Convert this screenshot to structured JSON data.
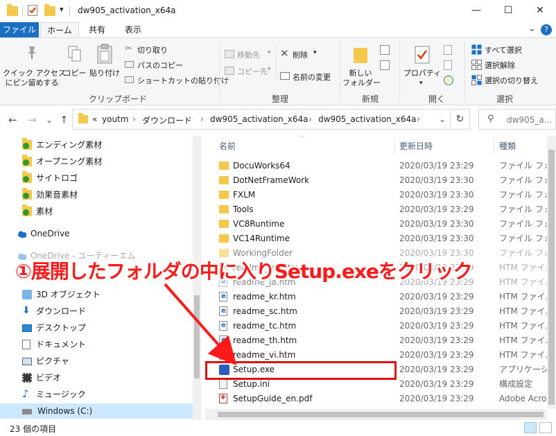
{
  "titlebar": {
    "title": "dw905_activation_x64a",
    "minimize": "—",
    "maximize": "☐",
    "close": "✕",
    "qat_dropdown": "▾"
  },
  "ribbon_tabs": {
    "file": "ファイル",
    "home": "ホーム",
    "share": "共有",
    "view": "表示",
    "collapse": "⌄",
    "help": "?"
  },
  "ribbon": {
    "clipboard": {
      "pin_quick_access": "クイック アクセス",
      "pin_quick_access_2": "にピン留めする",
      "copy": "コピー",
      "paste": "貼り付け",
      "cut": "切り取り",
      "copy_path": "パスのコピー",
      "paste_shortcut": "ショートカットの貼り付け",
      "group_label": "クリップボード"
    },
    "organize": {
      "move_to": "移動先",
      "copy_to": "コピー先",
      "delete": "削除",
      "rename": "名前の変更",
      "group_label": "整理"
    },
    "new": {
      "new_folder": "新しい",
      "new_folder_2": "フォルダー",
      "group_label": "新規"
    },
    "open": {
      "properties": "プロパティ",
      "group_label": "開く"
    },
    "select": {
      "select_all": "すべて選択",
      "select_none": "選択解除",
      "invert_selection": "選択の切り替え",
      "group_label": "選択"
    }
  },
  "address": {
    "back": "←",
    "forward": "→",
    "recent": "⌄",
    "up": "↑",
    "overflow": "«",
    "crumbs": [
      "youtm",
      "ダウンロード",
      "dw905_activation_x64a",
      "dw905_activation_x64a"
    ],
    "sep": "›",
    "dropdown": "⌄",
    "refresh": "↻",
    "search_placeholder": "dw905_a..."
  },
  "nav": {
    "items": [
      {
        "label": "エンディング素材"
      },
      {
        "label": "オープニング素材"
      },
      {
        "label": "サイトロゴ"
      },
      {
        "label": "効果音素材"
      },
      {
        "label": "素材"
      },
      {
        "label": "OneDrive"
      },
      {
        "label": "OneDrive - ユーティーエム"
      },
      {
        "label": "3D オブジェクト"
      },
      {
        "label": "ダウンロード"
      },
      {
        "label": "デスクトップ"
      },
      {
        "label": "ドキュメント"
      },
      {
        "label": "ピクチャ"
      },
      {
        "label": "ビデオ"
      },
      {
        "label": "ミュージック"
      },
      {
        "label": "Windows (C:)"
      }
    ]
  },
  "filelist": {
    "columns": {
      "name": "名前",
      "date": "更新日時",
      "type": "種類"
    },
    "rows": [
      {
        "name": "DocuWorks64",
        "date": "2020/03/19 23:29",
        "type": "ファイル フォル"
      },
      {
        "name": "DotNetFrameWork",
        "date": "2020/03/19 23:30",
        "type": "ファイル フォル"
      },
      {
        "name": "FXLM",
        "date": "2020/03/19 23:30",
        "type": "ファイル フォル"
      },
      {
        "name": "Tools",
        "date": "2020/03/19 23:29",
        "type": "ファイル フォル"
      },
      {
        "name": "VC8Runtime",
        "date": "2020/03/19 23:30",
        "type": "ファイル フォル"
      },
      {
        "name": "VC14Runtime",
        "date": "2020/03/19 23:30",
        "type": "ファイル フォル"
      },
      {
        "name": "WorkingFolder",
        "date": "2020/03/19 23:30",
        "type": "ファイル フォル"
      },
      {
        "name": "readme_en.htm",
        "date": "2020/03/19 23:29",
        "type": "HTM ファイル"
      },
      {
        "name": "readme_ja.htm",
        "date": "2020/03/19 23:29",
        "type": "HTM ファイル"
      },
      {
        "name": "readme_kr.htm",
        "date": "2020/03/19 23:29",
        "type": "HTM ファイル"
      },
      {
        "name": "readme_sc.htm",
        "date": "2020/03/19 23:29",
        "type": "HTM ファイル"
      },
      {
        "name": "readme_tc.htm",
        "date": "2020/03/19 23:29",
        "type": "HTM ファイル"
      },
      {
        "name": "readme_th.htm",
        "date": "2020/03/19 23:29",
        "type": "HTM ファイル"
      },
      {
        "name": "readme_vi.htm",
        "date": "2020/03/19 23:29",
        "type": "HTM ファイル"
      },
      {
        "name": "Setup.exe",
        "date": "2020/03/19 23:29",
        "type": "アプリケーション"
      },
      {
        "name": "Setup.ini",
        "date": "2020/03/19 23:29",
        "type": "構成設定"
      },
      {
        "name": "SetupGuide_en.pdf",
        "date": "2020/03/19 23:29",
        "type": "Adobe Acrol"
      }
    ]
  },
  "status": {
    "item_count": "23 個の項目"
  },
  "annotation": {
    "text": "①展開したフォルダの中に入りSetup.exeをクリック"
  },
  "colors": {
    "accent": "#1a6fc4",
    "annotation_red": "#ff1a1a",
    "folder_yellow": "#f3c84b"
  }
}
